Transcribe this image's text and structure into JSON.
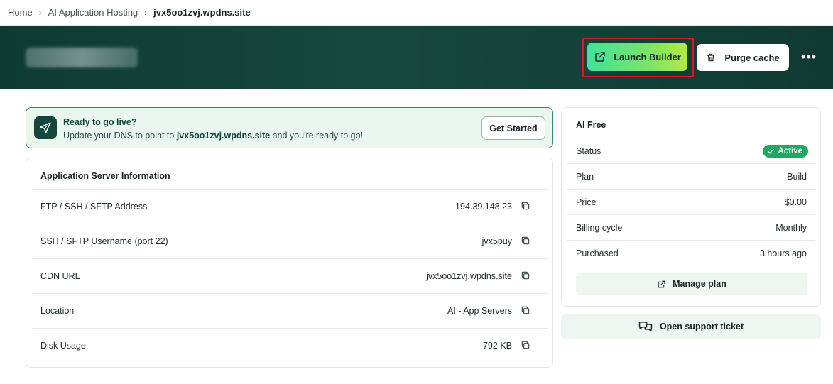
{
  "breadcrumb": {
    "items": [
      "Home",
      "AI Application Hosting",
      "jvx5oo1zvj.wpdns.site"
    ],
    "separator": "›"
  },
  "header": {
    "launch_builder_label": "Launch Builder",
    "purge_cache_label": "Purge cache",
    "more_label": "•••"
  },
  "golive": {
    "title": "Ready to go live?",
    "desc_prefix": "Update your DNS to point to ",
    "desc_domain": "jvx5oo1zvj.wpdns.site",
    "desc_suffix": " and you're ready to go!",
    "button_label": "Get Started"
  },
  "server_info": {
    "title": "Application Server Information",
    "rows": [
      {
        "label": "FTP / SSH / SFTP Address",
        "value": "194.39.148.23"
      },
      {
        "label": "SSH / SFTP Username (port 22)",
        "value": "jvx5puy"
      },
      {
        "label": "CDN URL",
        "value": "jvx5oo1zvj.wpdns.site"
      },
      {
        "label": "Location",
        "value": "AI - App Servers"
      },
      {
        "label": "Disk Usage",
        "value": "792 KB"
      }
    ]
  },
  "plan": {
    "title": "AI Free",
    "status_label": "Status",
    "status_value": "Active",
    "rows": [
      {
        "label": "Plan",
        "value": "Build"
      },
      {
        "label": "Price",
        "value": "$0.00"
      },
      {
        "label": "Billing cycle",
        "value": "Monthly"
      },
      {
        "label": "Purchased",
        "value": "3 hours ago"
      }
    ],
    "manage_label": "Manage plan"
  },
  "support": {
    "label": "Open support ticket"
  },
  "colors": {
    "header_bg": "#0d3b33",
    "accent_green": "#3fe39a",
    "accent_lime": "#b5ea3e",
    "active_badge": "#1fa764",
    "highlight": "#e3141b"
  }
}
